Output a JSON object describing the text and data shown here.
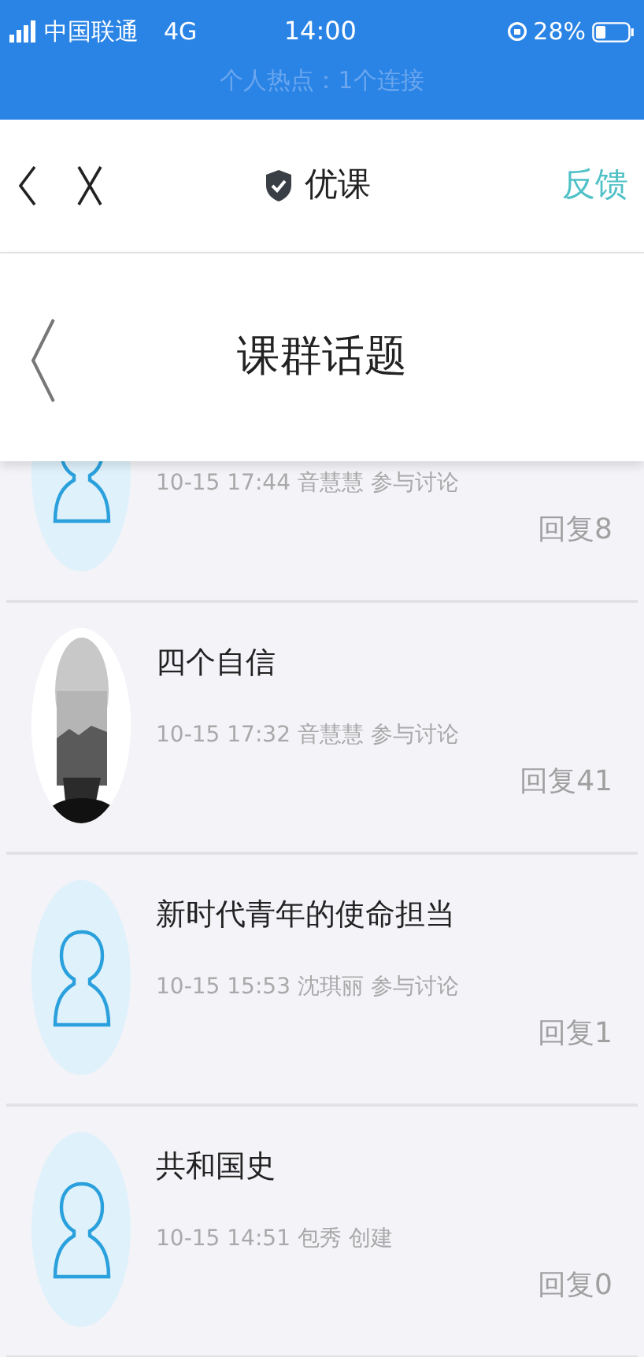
{
  "status_bar": {
    "carrier": "中国联通",
    "network": "4G",
    "time": "14:00",
    "battery": "28%",
    "hotspot": "个人热点：1个连接"
  },
  "nav_bar": {
    "title": "优课",
    "action": "反馈"
  },
  "page_header": {
    "title": "课群话题"
  },
  "topics": [
    {
      "kind": "default",
      "meta": "10-15 17:44 音慧慧 参与讨论",
      "replies": "回复8"
    },
    {
      "kind": "picture",
      "title": "四个自信",
      "meta": "10-15 17:32 音慧慧 参与讨论",
      "replies": "回复41"
    },
    {
      "kind": "default",
      "title": "新时代青年的使命担当",
      "meta": "10-15 15:53 沈琪丽 参与讨论",
      "replies": "回复1"
    },
    {
      "kind": "default",
      "title": "共和国史",
      "meta": "10-15 14:51 包秀 创建",
      "replies": "回复0"
    }
  ]
}
